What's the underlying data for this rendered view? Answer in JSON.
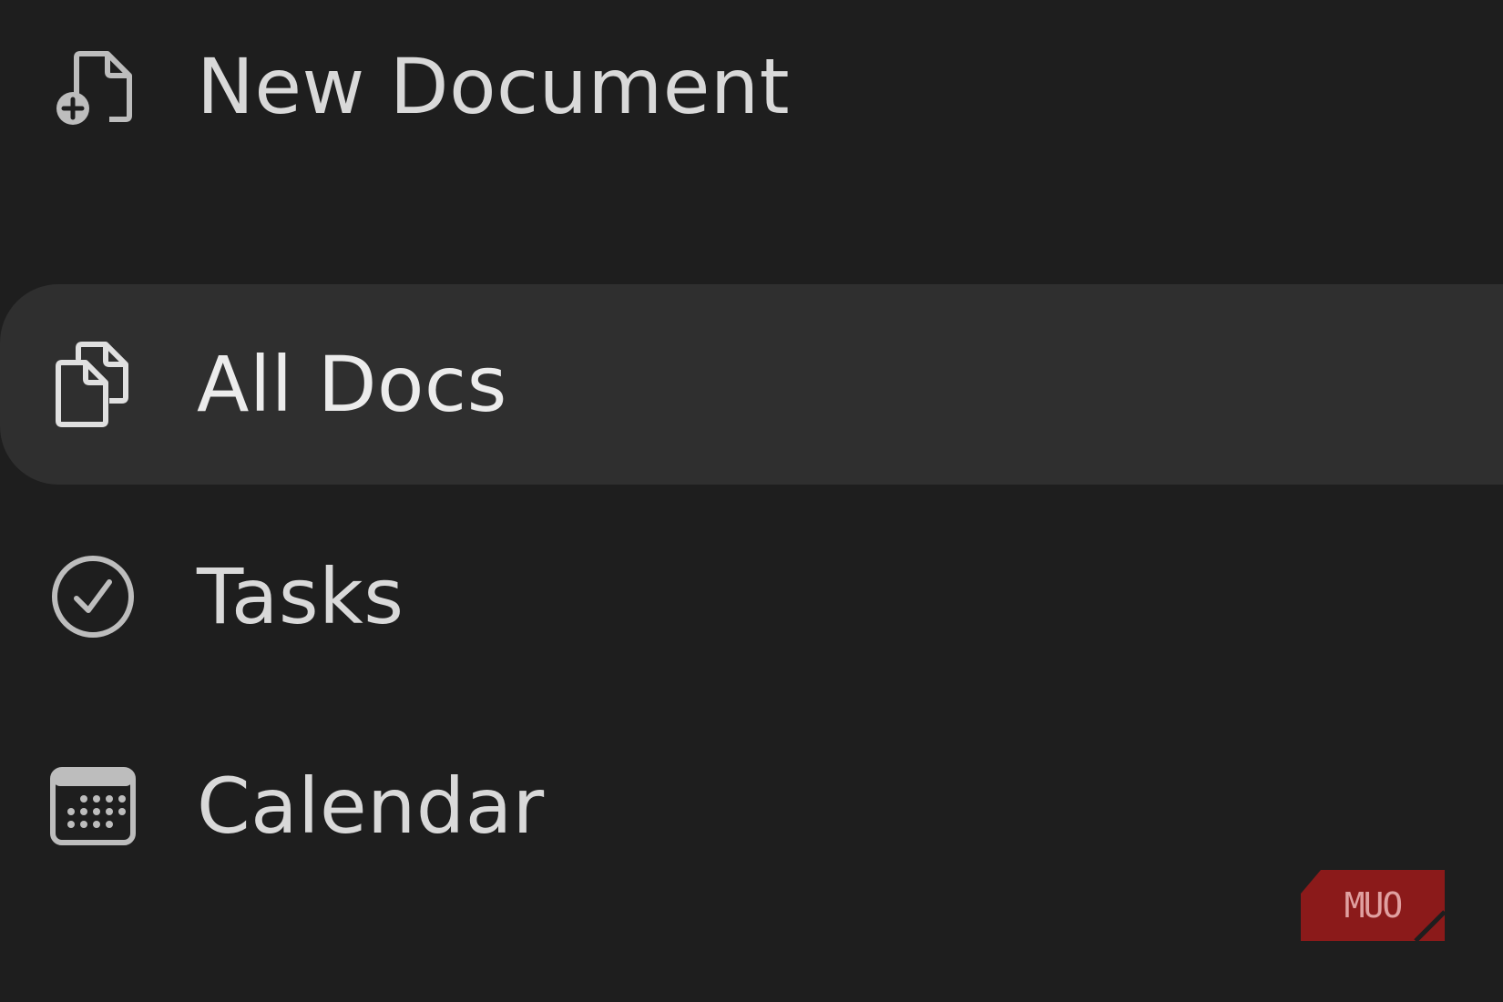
{
  "sidebar": {
    "items": [
      {
        "label": "New Document",
        "icon": "new-document-icon"
      },
      {
        "label": "All Docs",
        "icon": "all-docs-icon",
        "selected": true
      },
      {
        "label": "Tasks",
        "icon": "check-circle-icon"
      },
      {
        "label": "Calendar",
        "icon": "calendar-icon"
      }
    ]
  },
  "colors": {
    "background": "#1e1e1e",
    "selected_background": "#2f2f2f",
    "text": "#d9d9d9",
    "icon": "#bdbdbd",
    "watermark": "#8b1a1a"
  },
  "watermark": {
    "text": "MUO"
  }
}
